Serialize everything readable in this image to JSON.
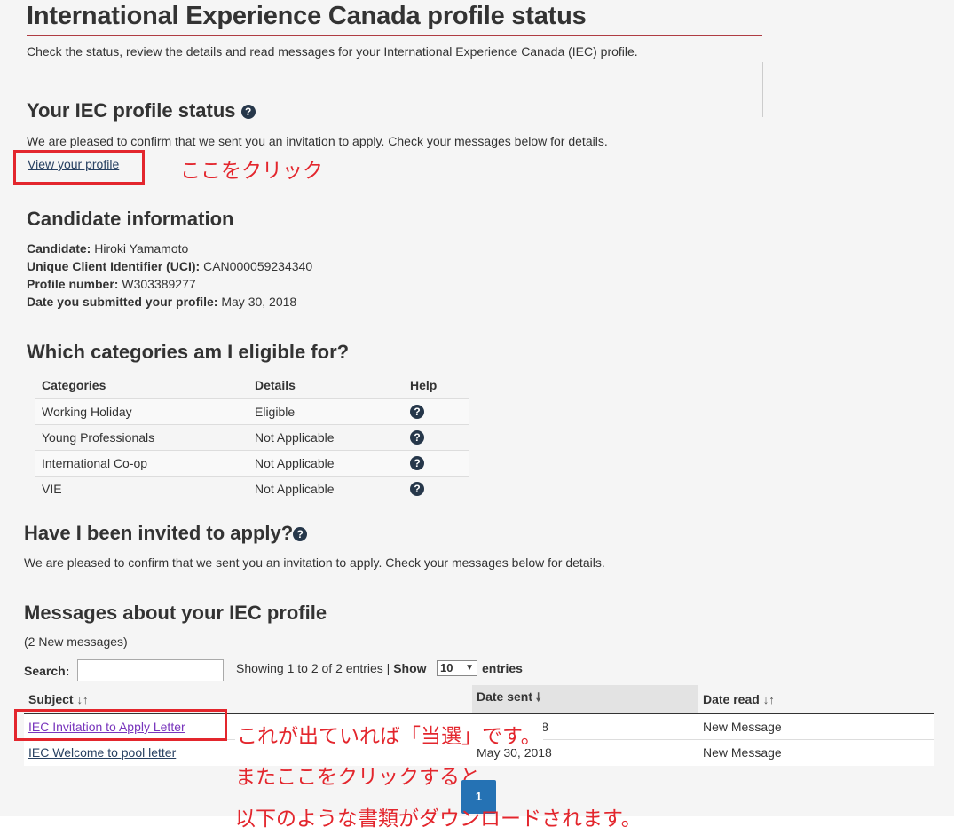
{
  "header": {
    "title": "International Experience Canada profile status",
    "lead": "Check the status, review the details and read messages for your International Experience Canada (IEC) profile."
  },
  "status_section": {
    "heading": "Your IEC profile status",
    "help_icon": "question-circle-icon",
    "message": "We are pleased to confirm that we sent you an invitation to apply. Check your messages below for details.",
    "view_profile_link": "View your profile"
  },
  "candidate": {
    "heading": "Candidate information",
    "rows": [
      {
        "label": "Candidate:",
        "value": "Hiroki Yamamoto"
      },
      {
        "label": "Unique Client Identifier (UCI):",
        "value": "CAN000059234340"
      },
      {
        "label": "Profile number:",
        "value": "W303389277"
      },
      {
        "label": "Date you submitted your profile:",
        "value": "May 30, 2018"
      }
    ]
  },
  "categories": {
    "heading": "Which categories am I eligible for?",
    "columns": [
      "Categories",
      "Details",
      "Help"
    ],
    "rows": [
      {
        "category": "Working Holiday",
        "details": "Eligible"
      },
      {
        "category": "Young Professionals",
        "details": "Not Applicable"
      },
      {
        "category": "International Co-op",
        "details": "Not Applicable"
      },
      {
        "category": "VIE",
        "details": "Not Applicable"
      }
    ]
  },
  "invited": {
    "heading": "Have I been invited to apply?",
    "message": "We are pleased to confirm that we sent you an invitation to apply. Check your messages below for details."
  },
  "messages": {
    "heading": "Messages about your IEC profile",
    "new_count": "(2 New messages)",
    "search_label": "Search:",
    "search_value": "",
    "showing": "Showing 1 to 2 of 2 entries",
    "separator": "|",
    "show_label": "Show",
    "page_size": "10",
    "entries_label": "entries",
    "columns": {
      "subject": "Subject",
      "date_sent": "Date sent",
      "date_read": "Date read"
    },
    "rows": [
      {
        "subject": "IEC Invitation to Apply Letter",
        "date_sent": "June 4, 2018",
        "date_read": "New Message"
      },
      {
        "subject": "IEC Welcome to pool letter",
        "date_sent": "May 30, 2018",
        "date_read": "New Message"
      }
    ],
    "current_page": "1"
  },
  "annotations": {
    "click_here": "ここをクリック",
    "line1": "これが出ていれば「当選」です。",
    "line2": "またここをクリックすると",
    "line3": "以下のような書類がダウンロードされます。",
    "color": "#e3262d"
  },
  "colors": {
    "accent_rule": "#af3c43",
    "link": "#284162",
    "visited_link": "#7834bc",
    "pager": "#2572b4",
    "help_icon": "#26374a"
  }
}
